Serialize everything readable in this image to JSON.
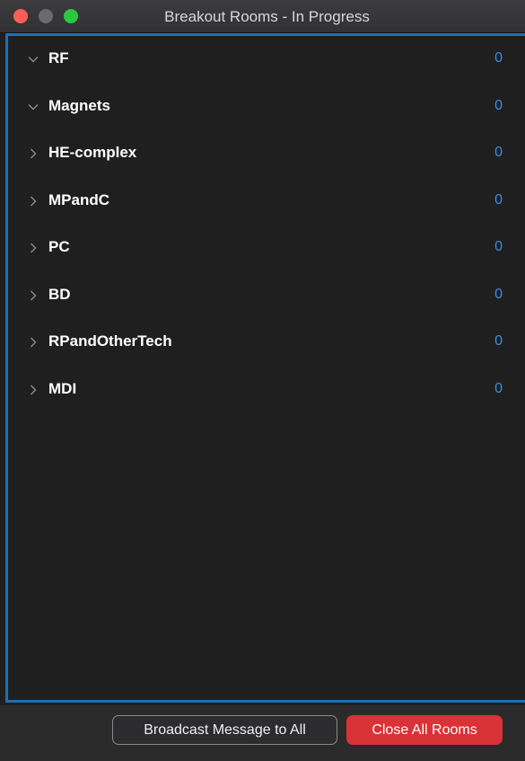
{
  "window": {
    "title": "Breakout Rooms - In Progress"
  },
  "rooms": [
    {
      "name": "RF",
      "count": "0",
      "expanded": true
    },
    {
      "name": "Magnets",
      "count": "0",
      "expanded": true
    },
    {
      "name": "HE-complex",
      "count": "0",
      "expanded": false
    },
    {
      "name": "MPandC",
      "count": "0",
      "expanded": false
    },
    {
      "name": "PC",
      "count": "0",
      "expanded": false
    },
    {
      "name": "BD",
      "count": "0",
      "expanded": false
    },
    {
      "name": "RPandOtherTech",
      "count": "0",
      "expanded": false
    },
    {
      "name": "MDI",
      "count": "0",
      "expanded": false
    }
  ],
  "footer": {
    "broadcast_label": "Broadcast Message to All",
    "close_label": "Close All Rooms"
  },
  "colors": {
    "accent": "#1f6fb3",
    "count": "#3a8ee6",
    "danger": "#d93237"
  }
}
